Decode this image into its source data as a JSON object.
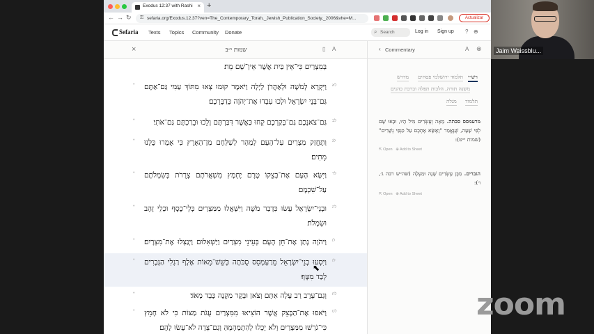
{
  "browser": {
    "tab_title": "Exodus 12:37 with Rashi",
    "tab_close": "×",
    "new_tab": "+",
    "url": "sefaria.org/Exodus.12.37?ven=The_Contemporary_Torah,_Jewish_Publication_Society,_2006&vhe=M...",
    "update_label": "Actualizar",
    "back": "←",
    "forward": "→",
    "reload": "↻",
    "lock": "🔒"
  },
  "header": {
    "logo": "Sefaria",
    "nav": [
      "Texts",
      "Topics",
      "Community",
      "Donate"
    ],
    "search_placeholder": "Search",
    "search_icon": "search-icon",
    "login": "Log in",
    "signup": "Sign up",
    "help_icon": "?",
    "globe_icon": "⊕"
  },
  "reader": {
    "close": "×",
    "title": "שמות י״ב",
    "bookmark_icon": "▯",
    "font_icon": "A",
    "verses": [
      {
        "num": "",
        "text": "בְּמִצְרַיִם כִּי־אֵין בַּיִת אֲשֶׁר אֵין־שָׁם מֵת׃"
      },
      {
        "num": "לא",
        "text": "וַיִּקְרָא לְמֹשֶׁה וּלְאַהֲרֹן לַיְלָה וַיֹּאמֶר קוּמוּ צְּאוּ מִתּוֹךְ עַמִּי גַּם־אַתֶּם גַּם־בְּנֵי יִשְׂרָאֵל וּלְכוּ עִבְדוּ אֶת־יְהֹוָה כְּדַבֶּרְכֶם׃"
      },
      {
        "num": "לב",
        "text": "גַּם־צֹאנְכֶם גַּם־בְּקַרְכֶם קְחוּ כַּאֲשֶׁר דִּבַּרְתֶּם וָלֵכוּ וּבֵרַכְתֶּם גַּם־אֹתִי׃"
      },
      {
        "num": "לג",
        "text": "וַתֶּחֱזַק מִצְרַיִם עַל־הָעָם לְמַהֵר לְשַׁלְּחָם מִן־הָאָרֶץ כִּי אָמְרוּ כֻּלָּנוּ מֵתִים׃"
      },
      {
        "num": "לד",
        "text": "וַיִּשָּׂא הָעָם אֶת־בְּצֵקוֹ טֶרֶם יֶחְמָץ מִשְׁאֲרֹתָם צְרֻרֹת בְּשִׂמְלֹתָם עַל־שִׁכְמָם׃"
      },
      {
        "num": "לה",
        "text": "וּבְנֵי־יִשְׂרָאֵל עָשׂוּ כִּדְבַר מֹשֶׁה וַיִּשְׁאֲלוּ מִמִּצְרַיִם כְּלֵי־כֶסֶף וּכְלֵי זָהָב וּשְׂמָלֹת׃"
      },
      {
        "num": "לו",
        "text": "וַיהֹוָה נָתַן אֶת־חֵן הָעָם בְּעֵינֵי מִצְרַיִם וַיַּשְׁאִלוּם וַיְנַצְּלוּ אֶת־מִצְרָיִם׃ (פ)"
      },
      {
        "num": "לז",
        "text": "וַיִּסְעוּ בְנֵי־יִשְׂרָאֵל מֵרַעְמְסֵס סֻכֹּתָה כְּשֵׁשׁ־מֵאוֹת אֶלֶף רַגְלִי הַגְּבָרִים לְבַד מִטָּף׃"
      },
      {
        "num": "לח",
        "text": "וְגַם־עֵרֶב רַב עָלָה אִתָּם וְצֹאן וּבָקָר מִקְנֶה כָּבֵד מְאֹד׃"
      },
      {
        "num": "לט",
        "text": "וַיֹּאפוּ אֶת־הַבָּצֵק אֲשֶׁר הוֹצִיאוּ מִמִּצְרַיִם עֻגֹת מַצּוֹת כִּי לֹא חָמֵץ כִּי־גֹרְשׁוּ מִמִּצְרַיִם וְלֹא יָכְלוּ לְהִתְמַהְמֵהַּ וְגַם־צֵדָה לֹא־עָשׂוּ לָהֶם׃"
      }
    ]
  },
  "commentary": {
    "back": "‹",
    "title": "Commentary",
    "font_icon": "A",
    "close": "⊗",
    "tabs": [
      {
        "label": "רש״י",
        "active": true
      },
      {
        "label": "תלמוד ירושלמי פסחים",
        "active": false
      },
      {
        "label": "מדרש",
        "active": false
      },
      {
        "label": "משנה תורה, הלכות תפלה וברכת כהנים",
        "active": false
      },
      {
        "label": "תלמוד",
        "active": false
      },
      {
        "label": "מגלה",
        "active": false
      }
    ],
    "entries": [
      {
        "head": "מרעמסס סכתה.",
        "body": " מֵאָה וְעֶשְׂרִים מִיל הָיוּ, וּבָאוּ שָׁם לְפִי שָׁעָה, שֶׁנֶּאֱמַר \"וָאֶשָּׂא אֶתְכֶם עַל כַּנְפֵי נְשָׁרִים\" (שמות י״ט):",
        "open": "Open",
        "add": "Add to Sheet"
      },
      {
        "head": "הגברים.",
        "body": " מִבֶּן עֶשְׂרִים שָׁנָה וּמַעְלָה (שה״ש רבה ג׳, ו׳):",
        "open": "Open",
        "add": "Add to Sheet"
      }
    ]
  },
  "video": {
    "participant_name": "Jaim Waissblu..."
  },
  "zoom_logo": "zoom",
  "colors": {
    "accent": "#18345d",
    "update": "#d93025",
    "highlight": "#eef1f7"
  }
}
